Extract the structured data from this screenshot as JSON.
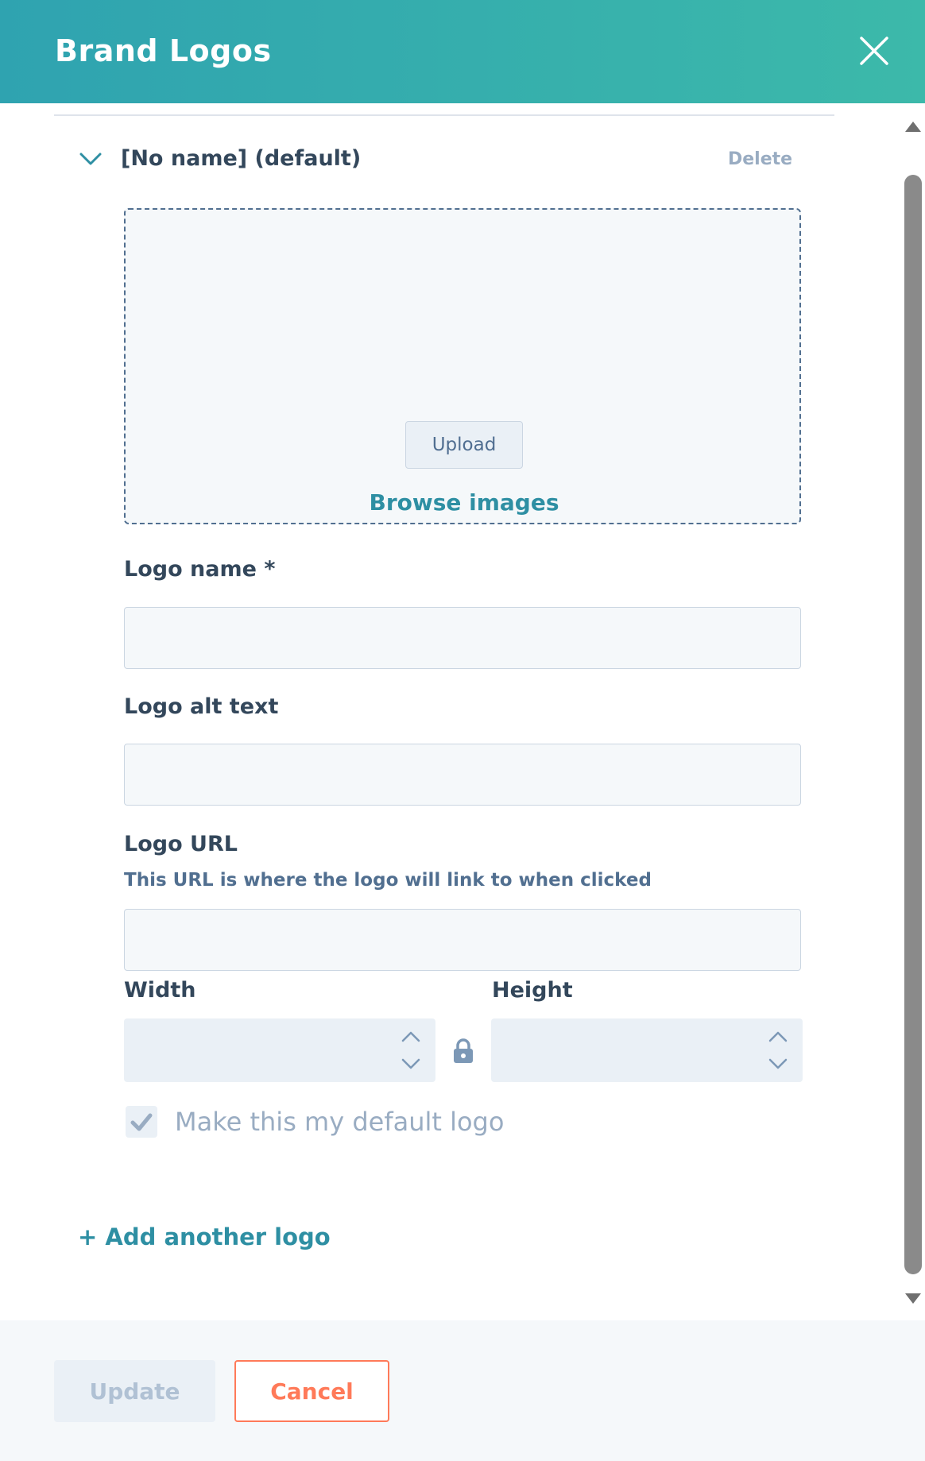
{
  "header": {
    "title": "Brand Logos",
    "close_icon": "close-icon"
  },
  "logo_section": {
    "title": "[No name] (default)",
    "delete_label": "Delete",
    "chevron_icon": "chevron-down-icon",
    "upload_label": "Upload",
    "browse_label": "Browse images"
  },
  "form": {
    "logo_name_label": "Logo name *",
    "logo_name_value": "",
    "logo_alt_label": "Logo alt text",
    "logo_alt_value": "",
    "logo_url_label": "Logo URL",
    "logo_url_help": "This URL is where the logo will link to when clicked",
    "logo_url_value": "",
    "width_label": "Width",
    "width_value": "",
    "height_label": "Height",
    "height_value": "",
    "lock_icon": "lock-icon",
    "default_checkbox_label": "Make this my default logo",
    "default_checkbox_checked": true
  },
  "add_logo_label": "+ Add another logo",
  "footer": {
    "update_label": "Update",
    "cancel_label": "Cancel"
  },
  "colors": {
    "header_start": "#2fa3b0",
    "header_end": "#3cb9aa",
    "link": "#2e8fa3",
    "cancel_accent": "#ff7a59",
    "text_primary": "#33475b",
    "text_muted": "#99acc2"
  }
}
